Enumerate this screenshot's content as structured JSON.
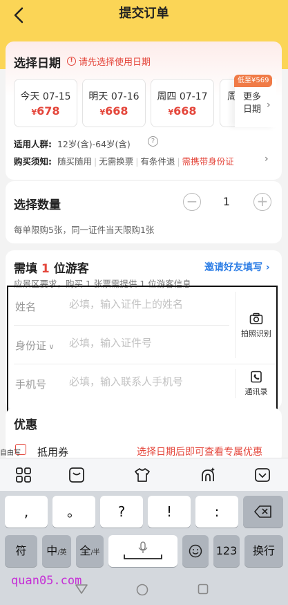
{
  "header": {
    "title": "提交订单"
  },
  "date_section": {
    "title": "选择日期",
    "warning": "请先选择使用日期",
    "dates": [
      {
        "label": "今天 07-15",
        "currency": "¥",
        "price": "678"
      },
      {
        "label": "明天 07-16",
        "currency": "¥",
        "price": "668"
      },
      {
        "label": "周四 07-17",
        "currency": "¥",
        "price": "668"
      }
    ],
    "more_line1": "更多",
    "more_line2": "日期",
    "low_badge": "低至¥569",
    "crowd_label": "适用人群:",
    "crowd_value": "12岁(含)-64岁(含)",
    "notice_label": "购买须知:",
    "notice_tags": [
      "随买随用",
      "无需换票",
      "有条件退"
    ],
    "notice_tag_red": "需携带身份证"
  },
  "quantity_section": {
    "title": "选择数量",
    "value": "1",
    "note": "每单限购5张，同一证件当天限购1张"
  },
  "visitor_section": {
    "title_prefix": "需填",
    "title_num": "1",
    "title_suffix": "位游客",
    "invite": "邀请好友填写",
    "note": "应景区要求，购买 1 张票需提供 1 位游客信息",
    "name_label": "姓名",
    "name_placeholder": "必填，输入证件上的姓名",
    "id_label": "身份证",
    "id_placeholder": "必填，输入证件号",
    "phone_label": "手机号",
    "phone_placeholder": "必填，输入联系人手机号",
    "scan_label": "拍照识别",
    "contacts_label": "通讯录"
  },
  "promo_section": {
    "title": "优惠",
    "coupon_label": "抵用券",
    "coupon_note": "选择日期后即可查看专属优惠",
    "self_write": "自由写"
  },
  "keyboard": {
    "row1": [
      ",",
      "。",
      "?",
      "!",
      ":"
    ],
    "fu": "符",
    "zh": "中",
    "zh_sub": "/英",
    "quan": "全",
    "quan_sub": "/半",
    "num": "123",
    "enter": "换行"
  },
  "watermark": "quan05.com",
  "colors": {
    "accent": "#fbd556",
    "price": "#e4463b",
    "link": "#2f7fe6"
  }
}
